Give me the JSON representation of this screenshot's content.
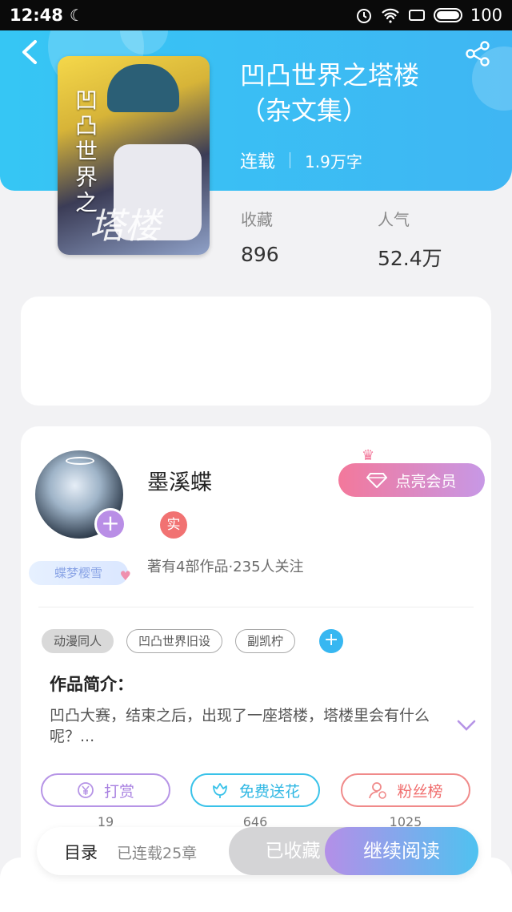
{
  "status_bar": {
    "time": "12:48",
    "battery": "100"
  },
  "book": {
    "title_line1": "凹凸世界之塔楼",
    "title_line2": "（杂文集）",
    "status": "连载",
    "word_count": "1.9万字",
    "cover_text": "凹凸世界之",
    "cover_script": "塔楼",
    "favorites_label": "收藏",
    "favorites_value": "896",
    "popularity_label": "人气",
    "popularity_value": "52.4万"
  },
  "author": {
    "name": "墨溪蝶",
    "real_badge": "实",
    "nick_badge": "蝶梦樱雪",
    "stats": "著有4部作品·235人关注",
    "vip_button": "点亮会员"
  },
  "tags": [
    "动漫同人",
    "凹凸世界旧设",
    "副凯柠"
  ],
  "intro": {
    "title": "作品简介：",
    "text": "凹凸大赛，结束之后，出现了一座塔楼，塔楼里会有什么呢？..."
  },
  "actions": [
    {
      "label": "打赏",
      "count": "19"
    },
    {
      "label": "免费送花",
      "count": "646"
    },
    {
      "label": "粉丝榜",
      "count": "1025"
    }
  ],
  "bottom": {
    "toc_label": "目录",
    "toc_count": "已连载25章",
    "collected": "已收藏",
    "continue_read": "继续阅读"
  },
  "colors": {
    "header_blue": "#36c6f4",
    "purple": "#b694e6",
    "cyan": "#39c2e9",
    "coral": "#f08a8a",
    "vip_pink": "#f3789b"
  }
}
